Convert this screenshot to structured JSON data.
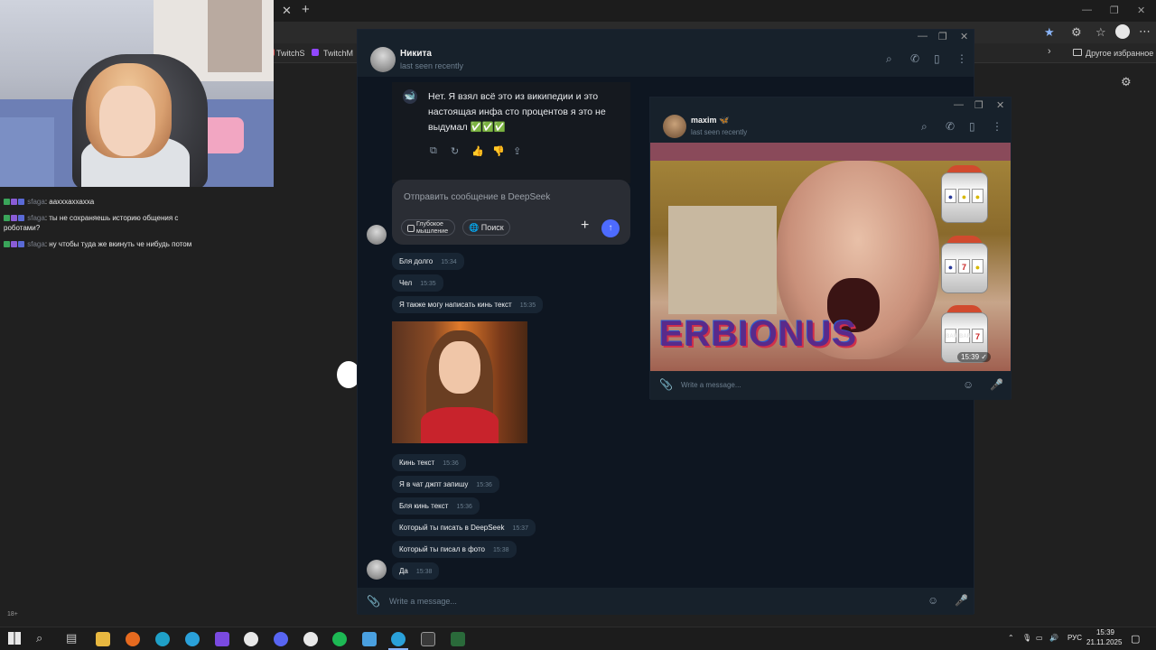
{
  "browser": {
    "tab_close": "✕",
    "tab_new": "+",
    "bookmarks": [
      "TwitchS",
      "TwitchM"
    ],
    "other_bookmarks": "Другое избранное",
    "win_min": "—",
    "win_max": "❐",
    "win_close": "✕"
  },
  "stream_chat": [
    {
      "user": "sfaga",
      "text": ": аахххаххахха"
    },
    {
      "user": "sfaga",
      "text": ": ты не сохраняешь историю общения с роботами?"
    },
    {
      "user": "sfaga",
      "text": ": ну чтобы туда же вкинуть че нибудь потом"
    }
  ],
  "follow_tag": "18+",
  "tg1": {
    "name": "Никита",
    "status": "last seen recently",
    "deepseek_reply": "Нет. Я взял всё это из википедии и это настоящая инфа сто процентов я это не выдумал ✅✅✅",
    "deepseek_placeholder": "Отправить сообщение в DeepSeek",
    "chip_think": "Глубокое мышление",
    "chip_search": "Поиск",
    "deepseek_avatar_label": "DEEPSEEK",
    "compose_placeholder": "Write a message...",
    "messages": [
      {
        "text": "Бля долго",
        "time": "15:34"
      },
      {
        "text": "Чел",
        "time": "15:35"
      },
      {
        "text": "Я также могу написать кинь текст",
        "time": "15:35"
      },
      {
        "text": "Кинь текст",
        "time": "15:36"
      },
      {
        "text": "Я в чат джпт запишу",
        "time": "15:36"
      },
      {
        "text": "Бля кинь текст",
        "time": "15:36"
      },
      {
        "text": "Который ты писать в DeepSeek",
        "time": "15:37"
      },
      {
        "text": "Который ты писал в фото",
        "time": "15:38"
      },
      {
        "text": "Да",
        "time": "15:38"
      }
    ]
  },
  "tg2": {
    "name": "maxim 🦋",
    "status": "last seen recently",
    "video_caption": "ERBIONUS",
    "video_time": "15:39 ✓",
    "compose_placeholder": "Write a message..."
  },
  "taskbar": {
    "lang": "РУС",
    "time": "15:39",
    "date": "21.11.2025"
  }
}
